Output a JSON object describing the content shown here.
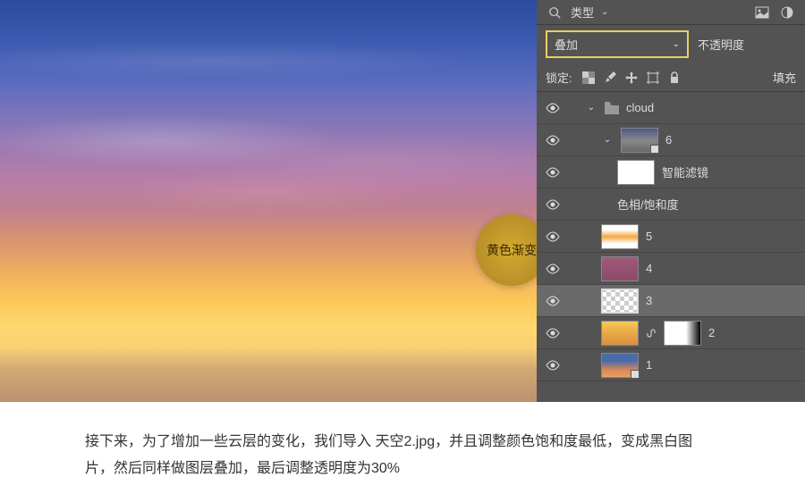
{
  "badge": {
    "label": "黄色渐变"
  },
  "panel": {
    "search_label": "类型",
    "blend_mode": "叠加",
    "opacity_label": "不透明度",
    "lock_label": "锁定:",
    "fill_label": "填充",
    "group_name": "cloud",
    "smart_filter_label": "智能滤镜",
    "hue_sat_label": "色相/饱和度",
    "layer_6": "6",
    "layer_5": "5",
    "layer_4": "4",
    "layer_3": "3",
    "layer_2": "2",
    "layer_1": "1"
  },
  "caption": "接下来，为了增加一些云层的变化，我们导入 天空2.jpg，并且调整颜色饱和度最低，变成黑白图片，然后同样做图层叠加，最后调整透明度为30%"
}
